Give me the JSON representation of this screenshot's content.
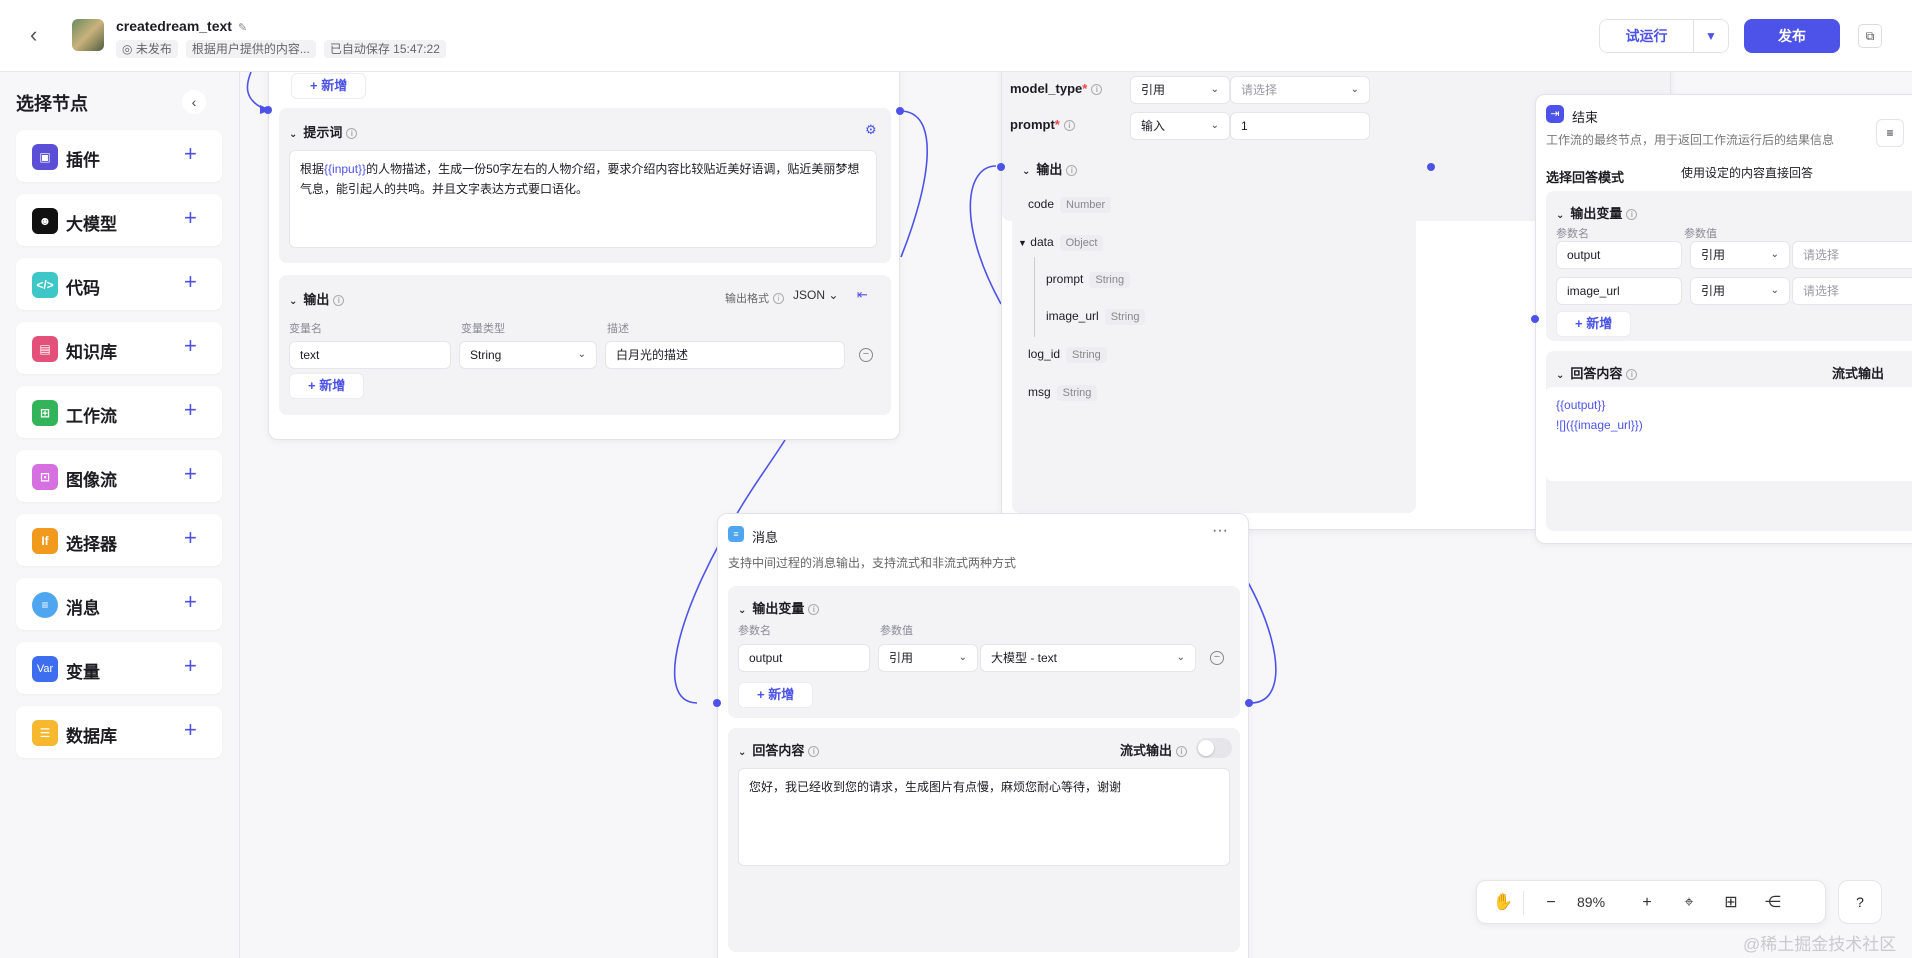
{
  "header": {
    "app_title": "createdream_text",
    "status": "未发布",
    "description": "根据用户提供的内容...",
    "autosave": "已自动保存 15:47:22",
    "run_label": "试运行",
    "publish_label": "发布"
  },
  "sidebar": {
    "title": "选择节点",
    "items": [
      {
        "label": "插件",
        "icon": "plugin-icon",
        "color": "#5a4fd6"
      },
      {
        "label": "大模型",
        "icon": "llm-icon",
        "color": "#111111"
      },
      {
        "label": "代码",
        "icon": "code-icon",
        "color": "#3fc6c6"
      },
      {
        "label": "知识库",
        "icon": "knowledge-icon",
        "color": "#e3517a"
      },
      {
        "label": "工作流",
        "icon": "workflow-icon",
        "color": "#34b45a"
      },
      {
        "label": "图像流",
        "icon": "imageflow-icon",
        "color": "#d66fe0"
      },
      {
        "label": "选择器",
        "icon": "selector-icon",
        "color": "#f29a1e"
      },
      {
        "label": "消息",
        "icon": "message-icon",
        "color": "#4fa6f0"
      },
      {
        "label": "变量",
        "icon": "variable-icon",
        "color": "#3e6ef0"
      },
      {
        "label": "数据库",
        "icon": "database-icon",
        "color": "#f5b82e"
      }
    ],
    "var_icon_text": "Var",
    "if_icon_text": "If"
  },
  "llm_node": {
    "add_label": "新增",
    "prompt_title": "提示词",
    "prompt_before": "根据",
    "prompt_var": "{{input}}",
    "prompt_after": "的人物描述，生成一份50字左右的人物介绍，要求介绍内容比较贴近美好语调，贴近美丽梦想气息，能引起人的共鸣。并且文字表达方式要口语化。",
    "output_title": "输出",
    "output_format_label": "输出格式",
    "output_format_value": "JSON",
    "col_name": "变量名",
    "col_type": "变量类型",
    "col_desc": "描述",
    "var_name": "text",
    "var_type": "String",
    "var_desc": "白月光的描述",
    "add2_label": "新增"
  },
  "plugin_node": {
    "model_type_label": "model_type",
    "model_type_mode": "引用",
    "model_type_placeholder": "请选择",
    "prompt_label": "prompt",
    "prompt_mode": "输入",
    "prompt_value": "1",
    "output_title": "输出",
    "outputs": [
      {
        "name": "code",
        "type": "Number"
      },
      {
        "name": "data",
        "type": "Object"
      },
      {
        "name": "prompt",
        "type": "String"
      },
      {
        "name": "image_url",
        "type": "String"
      },
      {
        "name": "log_id",
        "type": "String"
      },
      {
        "name": "msg",
        "type": "String"
      }
    ]
  },
  "message_node": {
    "title": "消息",
    "desc": "支持中间过程的消息输出，支持流式和非流式两种方式",
    "outvar_title": "输出变量",
    "col_param": "参数名",
    "col_value": "参数值",
    "param_name": "output",
    "param_mode": "引用",
    "param_value": "大模型 - text",
    "add_label": "新增",
    "answer_title": "回答内容",
    "stream_label": "流式输出",
    "answer_text": "您好，我已经收到您的请求，生成图片有点慢，麻烦您耐心等待，谢谢"
  },
  "end_node": {
    "title": "结束",
    "desc": "工作流的最终节点，用于返回工作流运行后的结果信息",
    "mode_label": "选择回答模式",
    "mode_value": "使用设定的内容直接回答",
    "outvar_title": "输出变量",
    "col_param": "参数名",
    "col_value": "参数值",
    "rows": [
      {
        "name": "output",
        "mode": "引用",
        "placeholder": "请选择"
      },
      {
        "name": "image_url",
        "mode": "引用",
        "placeholder": "请选择"
      }
    ],
    "add_label": "新增",
    "answer_title": "回答内容",
    "stream_label": "流式输出",
    "answer_line1": "{{output}}",
    "answer_line2": "![]({{image_url}})"
  },
  "toolbar": {
    "zoom": "89%"
  },
  "watermark": "@稀土掘金技术社区"
}
